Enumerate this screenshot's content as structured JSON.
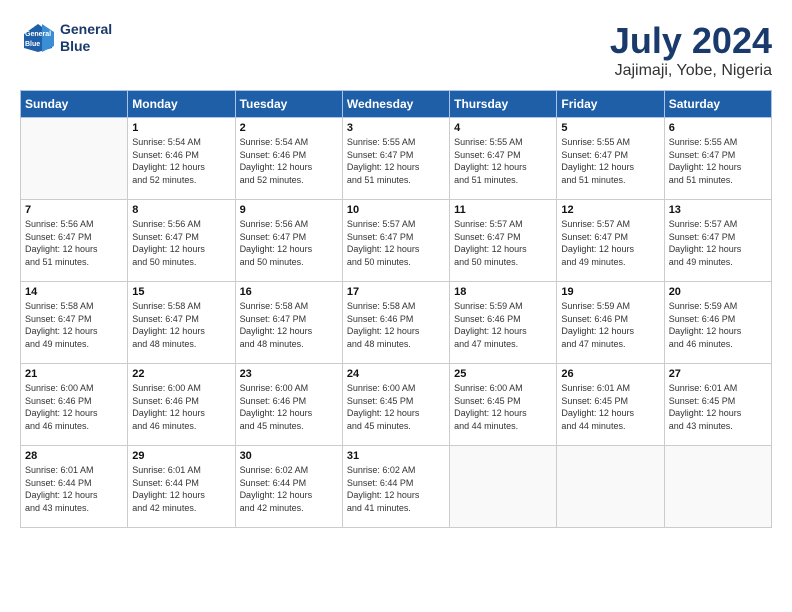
{
  "header": {
    "logo_line1": "General",
    "logo_line2": "Blue",
    "month_title": "July 2024",
    "location": "Jajimaji, Yobe, Nigeria"
  },
  "weekdays": [
    "Sunday",
    "Monday",
    "Tuesday",
    "Wednesday",
    "Thursday",
    "Friday",
    "Saturday"
  ],
  "weeks": [
    [
      {
        "day": "",
        "info": ""
      },
      {
        "day": "1",
        "info": "Sunrise: 5:54 AM\nSunset: 6:46 PM\nDaylight: 12 hours\nand 52 minutes."
      },
      {
        "day": "2",
        "info": "Sunrise: 5:54 AM\nSunset: 6:46 PM\nDaylight: 12 hours\nand 52 minutes."
      },
      {
        "day": "3",
        "info": "Sunrise: 5:55 AM\nSunset: 6:47 PM\nDaylight: 12 hours\nand 51 minutes."
      },
      {
        "day": "4",
        "info": "Sunrise: 5:55 AM\nSunset: 6:47 PM\nDaylight: 12 hours\nand 51 minutes."
      },
      {
        "day": "5",
        "info": "Sunrise: 5:55 AM\nSunset: 6:47 PM\nDaylight: 12 hours\nand 51 minutes."
      },
      {
        "day": "6",
        "info": "Sunrise: 5:55 AM\nSunset: 6:47 PM\nDaylight: 12 hours\nand 51 minutes."
      }
    ],
    [
      {
        "day": "7",
        "info": "Sunrise: 5:56 AM\nSunset: 6:47 PM\nDaylight: 12 hours\nand 51 minutes."
      },
      {
        "day": "8",
        "info": "Sunrise: 5:56 AM\nSunset: 6:47 PM\nDaylight: 12 hours\nand 50 minutes."
      },
      {
        "day": "9",
        "info": "Sunrise: 5:56 AM\nSunset: 6:47 PM\nDaylight: 12 hours\nand 50 minutes."
      },
      {
        "day": "10",
        "info": "Sunrise: 5:57 AM\nSunset: 6:47 PM\nDaylight: 12 hours\nand 50 minutes."
      },
      {
        "day": "11",
        "info": "Sunrise: 5:57 AM\nSunset: 6:47 PM\nDaylight: 12 hours\nand 50 minutes."
      },
      {
        "day": "12",
        "info": "Sunrise: 5:57 AM\nSunset: 6:47 PM\nDaylight: 12 hours\nand 49 minutes."
      },
      {
        "day": "13",
        "info": "Sunrise: 5:57 AM\nSunset: 6:47 PM\nDaylight: 12 hours\nand 49 minutes."
      }
    ],
    [
      {
        "day": "14",
        "info": "Sunrise: 5:58 AM\nSunset: 6:47 PM\nDaylight: 12 hours\nand 49 minutes."
      },
      {
        "day": "15",
        "info": "Sunrise: 5:58 AM\nSunset: 6:47 PM\nDaylight: 12 hours\nand 48 minutes."
      },
      {
        "day": "16",
        "info": "Sunrise: 5:58 AM\nSunset: 6:47 PM\nDaylight: 12 hours\nand 48 minutes."
      },
      {
        "day": "17",
        "info": "Sunrise: 5:58 AM\nSunset: 6:46 PM\nDaylight: 12 hours\nand 48 minutes."
      },
      {
        "day": "18",
        "info": "Sunrise: 5:59 AM\nSunset: 6:46 PM\nDaylight: 12 hours\nand 47 minutes."
      },
      {
        "day": "19",
        "info": "Sunrise: 5:59 AM\nSunset: 6:46 PM\nDaylight: 12 hours\nand 47 minutes."
      },
      {
        "day": "20",
        "info": "Sunrise: 5:59 AM\nSunset: 6:46 PM\nDaylight: 12 hours\nand 46 minutes."
      }
    ],
    [
      {
        "day": "21",
        "info": "Sunrise: 6:00 AM\nSunset: 6:46 PM\nDaylight: 12 hours\nand 46 minutes."
      },
      {
        "day": "22",
        "info": "Sunrise: 6:00 AM\nSunset: 6:46 PM\nDaylight: 12 hours\nand 46 minutes."
      },
      {
        "day": "23",
        "info": "Sunrise: 6:00 AM\nSunset: 6:46 PM\nDaylight: 12 hours\nand 45 minutes."
      },
      {
        "day": "24",
        "info": "Sunrise: 6:00 AM\nSunset: 6:45 PM\nDaylight: 12 hours\nand 45 minutes."
      },
      {
        "day": "25",
        "info": "Sunrise: 6:00 AM\nSunset: 6:45 PM\nDaylight: 12 hours\nand 44 minutes."
      },
      {
        "day": "26",
        "info": "Sunrise: 6:01 AM\nSunset: 6:45 PM\nDaylight: 12 hours\nand 44 minutes."
      },
      {
        "day": "27",
        "info": "Sunrise: 6:01 AM\nSunset: 6:45 PM\nDaylight: 12 hours\nand 43 minutes."
      }
    ],
    [
      {
        "day": "28",
        "info": "Sunrise: 6:01 AM\nSunset: 6:44 PM\nDaylight: 12 hours\nand 43 minutes."
      },
      {
        "day": "29",
        "info": "Sunrise: 6:01 AM\nSunset: 6:44 PM\nDaylight: 12 hours\nand 42 minutes."
      },
      {
        "day": "30",
        "info": "Sunrise: 6:02 AM\nSunset: 6:44 PM\nDaylight: 12 hours\nand 42 minutes."
      },
      {
        "day": "31",
        "info": "Sunrise: 6:02 AM\nSunset: 6:44 PM\nDaylight: 12 hours\nand 41 minutes."
      },
      {
        "day": "",
        "info": ""
      },
      {
        "day": "",
        "info": ""
      },
      {
        "day": "",
        "info": ""
      }
    ]
  ]
}
